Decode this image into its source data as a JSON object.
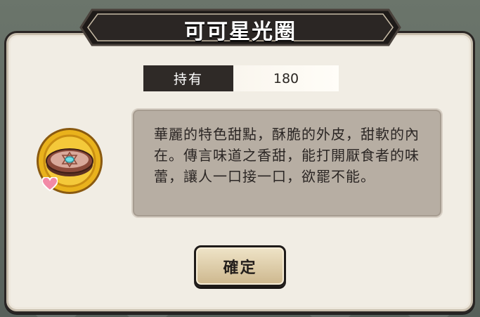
{
  "dialog": {
    "title": "可可星光圈",
    "owned_label": "持有",
    "owned_value": "180",
    "description": "華麗的特色甜點，酥脆的外皮，甜軟的內在。傳言味道之香甜，能打開厭食者的味蕾，讓人一口接一口，欲罷不能。",
    "confirm_label": "確定"
  },
  "icons": {
    "item": "cookie-donut-icon",
    "badge": "heart-icon"
  },
  "colors": {
    "title_bar": "#2b2624",
    "panel": "#f1ede4",
    "description_box": "#b7aea3",
    "icon_ring": "#e9b21c",
    "heart": "#f28aa6"
  }
}
